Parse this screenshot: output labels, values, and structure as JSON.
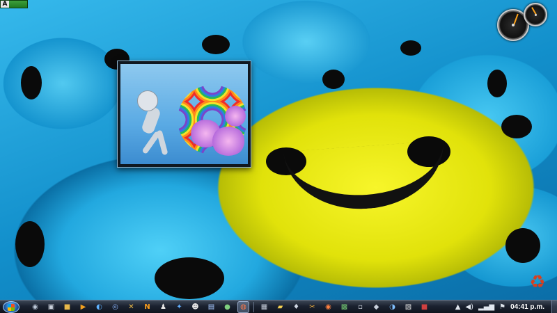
{
  "top_bar": {
    "label": "A"
  },
  "gadgets": {
    "gauges": [
      {
        "name": "cpu-meter",
        "level_fraction": 0.35
      },
      {
        "name": "ram-meter",
        "level_fraction": 0.55
      }
    ],
    "slideshow": {
      "subject": "rainbow cartoon"
    }
  },
  "taskbar": {
    "start_button": "windows-start-orb",
    "icons": [
      "camera-icon",
      "floppy-disk-icon",
      "lock-icon",
      "media-player-icon",
      "eye-icon",
      "chrome-icon",
      "x-tools-icon",
      "n-app-icon",
      "penguin-icon",
      "runner-icon",
      "people-icon",
      "document-icon",
      "chat-bubble-icon",
      "cd-player-icon",
      "film-icon",
      "folder-icon",
      "ink-drop-icon",
      "scissors-icon",
      "browser-icon",
      "network-icon",
      "settings-icon",
      "diamond-icon",
      "globe-icon",
      "gallery-icon",
      "games-icon"
    ],
    "active_index": 13,
    "tray": {
      "icons": [
        "arrow-up-icon",
        "speaker-icon",
        "network-bars-icon",
        "flag-icon"
      ],
      "clock": "04:41 p.m."
    }
  },
  "colors": {
    "wallpaper_blue": "#1a9fd8",
    "smiley_yellow": "#e8e80c",
    "taskbar": "#1b2230"
  }
}
